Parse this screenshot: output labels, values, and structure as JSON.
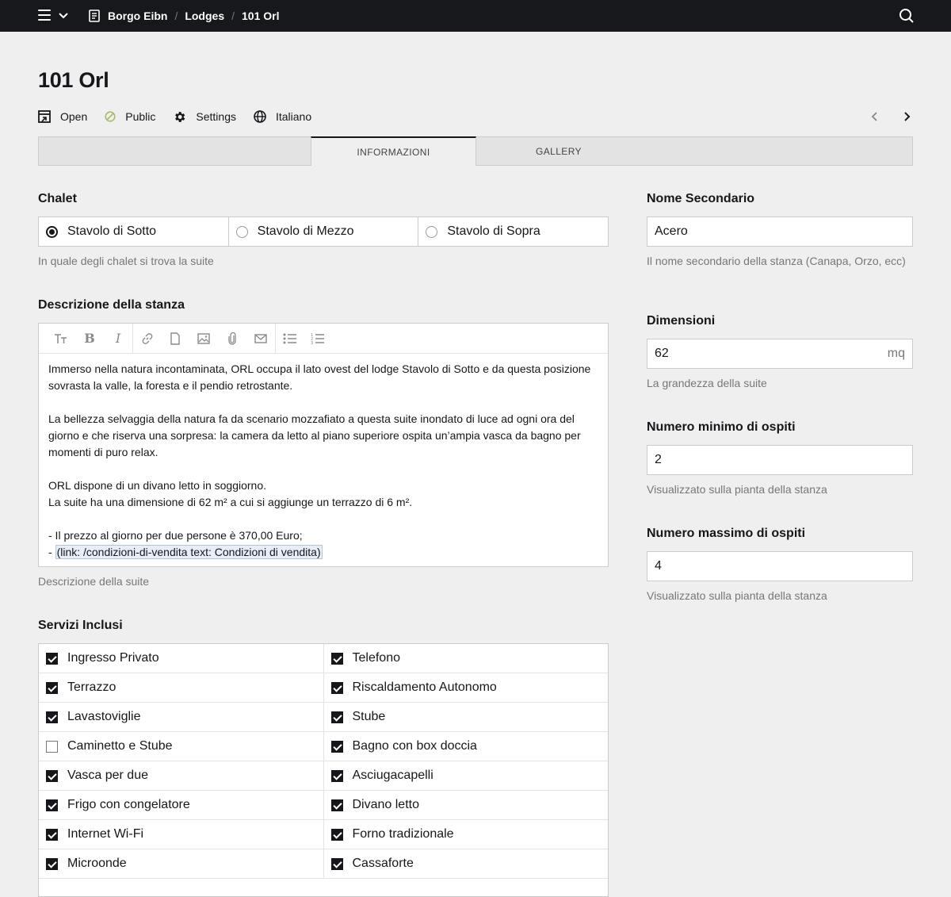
{
  "topbar": {
    "breadcrumbs": [
      "Borgo Eibn",
      "Lodges",
      "101 Orl"
    ]
  },
  "header": {
    "title": "101 Orl",
    "open_label": "Open",
    "status_label": "Public",
    "settings_label": "Settings",
    "language_label": "Italiano"
  },
  "tabs": [
    {
      "label": "Informazioni",
      "active": true
    },
    {
      "label": "Gallery",
      "active": false
    }
  ],
  "chalet": {
    "label": "Chalet",
    "options": [
      "Stavolo di Sotto",
      "Stavolo di Mezzo",
      "Stavolo di Sopra"
    ],
    "selected": "Stavolo di Sotto",
    "help": "In quale degli chalet si trova la suite"
  },
  "description": {
    "label": "Descrizione della stanza",
    "paragraphs": [
      "Immerso nella natura incontaminata, ORL occupa il lato ovest del lodge Stavolo di Sotto e da questa posizione sovrasta la valle, la foresta e il pendio retrostante.",
      "",
      "La bellezza selvaggia della natura fa da scenario mozzafiato a questa suite inondato di luce ad ogni ora del giorno e che riserva una sorpresa: la camera da letto al piano superiore ospita un’ampia vasca da bagno per momenti di puro relax.",
      "",
      "ORL dispone di un divano letto in soggiorno.",
      "La suite ha una dimensione di 62 m² a cui si aggiunge un terrazzo di 6 m².",
      "",
      "- Il prezzo al giorno per due persone è 370,00 Euro;"
    ],
    "last_prefix": "- ",
    "last_link": "(link: /condizioni-di-vendita text: Condizioni di vendita)",
    "help": "Descrizione della suite"
  },
  "services": {
    "label": "Servizi Inclusi",
    "rows": [
      [
        {
          "label": "Ingresso Privato",
          "checked": true
        },
        {
          "label": "Telefono",
          "checked": true
        }
      ],
      [
        {
          "label": "Terrazzo",
          "checked": true
        },
        {
          "label": "Riscaldamento Autonomo",
          "checked": true
        }
      ],
      [
        {
          "label": "Lavastoviglie",
          "checked": true
        },
        {
          "label": "Stube",
          "checked": true
        }
      ],
      [
        {
          "label": "Caminetto e Stube",
          "checked": false
        },
        {
          "label": "Bagno con box doccia",
          "checked": true
        }
      ],
      [
        {
          "label": "Vasca per due",
          "checked": true
        },
        {
          "label": "Asciugacapelli",
          "checked": true
        }
      ],
      [
        {
          "label": "Frigo con congelatore",
          "checked": true
        },
        {
          "label": "Divano letto",
          "checked": true
        }
      ],
      [
        {
          "label": "Internet Wi-Fi",
          "checked": true
        },
        {
          "label": "Forno tradizionale",
          "checked": true
        }
      ],
      [
        {
          "label": "Microonde",
          "checked": true
        },
        {
          "label": "Cassaforte",
          "checked": true
        }
      ]
    ]
  },
  "secondary_name": {
    "label": "Nome Secondario",
    "value": "Acero",
    "help": "Il nome secondario della stanza (Canapa, Orzo, ecc)"
  },
  "dimensions": {
    "label": "Dimensioni",
    "value": "62",
    "unit": "mq",
    "help": "La grandezza della suite"
  },
  "min_guests": {
    "label": "Numero minimo di ospiti",
    "value": "2",
    "help": "Visualizzato sulla pianta della stanza"
  },
  "max_guests": {
    "label": "Numero massimo di ospiti",
    "value": "4",
    "help": "Visualizzato sulla pianta della stanza"
  },
  "colors": {
    "topbar": "#17181b",
    "background": "#efefef",
    "status_green": "#a7bd68"
  }
}
